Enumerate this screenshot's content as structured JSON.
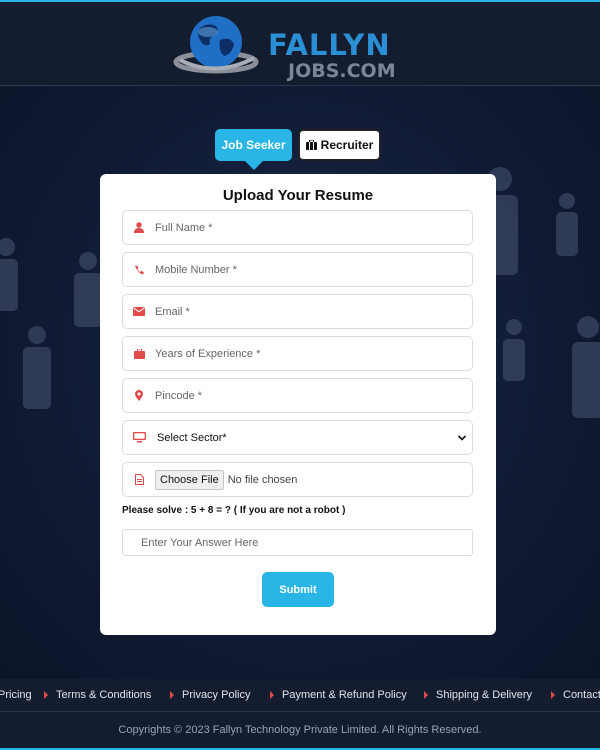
{
  "header": {
    "brand_line1": "FALLYN",
    "brand_line2": "JOBS.COM"
  },
  "tabs": {
    "job_seeker": "Job Seeker",
    "recruiter": "Recruiter"
  },
  "form": {
    "title": "Upload Your Resume",
    "fields": [
      {
        "placeholder": "Full Name *",
        "icon": "user-icon"
      },
      {
        "placeholder": "Mobile Number *",
        "icon": "phone-icon"
      },
      {
        "placeholder": "Email *",
        "icon": "envelope-icon"
      },
      {
        "placeholder": "Years of Experience *",
        "icon": "briefcase-icon"
      },
      {
        "placeholder": "Pincode *",
        "icon": "location-pin-icon"
      }
    ],
    "sector": {
      "selected": "Select Sector*",
      "icon": "monitor-icon"
    },
    "file": {
      "button": "Choose File",
      "status": "No file chosen",
      "icon": "file-icon"
    },
    "captcha_question": "Please solve : 5 + 8 = ? ( If you are not a robot )",
    "answer_placeholder": "Enter Your Answer Here",
    "submit_label": "Submit"
  },
  "footer": {
    "links": [
      "Pricing",
      "Terms & Conditions",
      "Privacy Policy",
      "Payment & Refund Policy",
      "Shipping & Delivery",
      "Contact"
    ],
    "copyright": "Copyrights © 2023 Fallyn Technology Private Limited. All Rights Reserved."
  },
  "colors": {
    "accent": "#29b6e6",
    "icon_red": "#e04a4a",
    "background": "#0f1a33"
  }
}
